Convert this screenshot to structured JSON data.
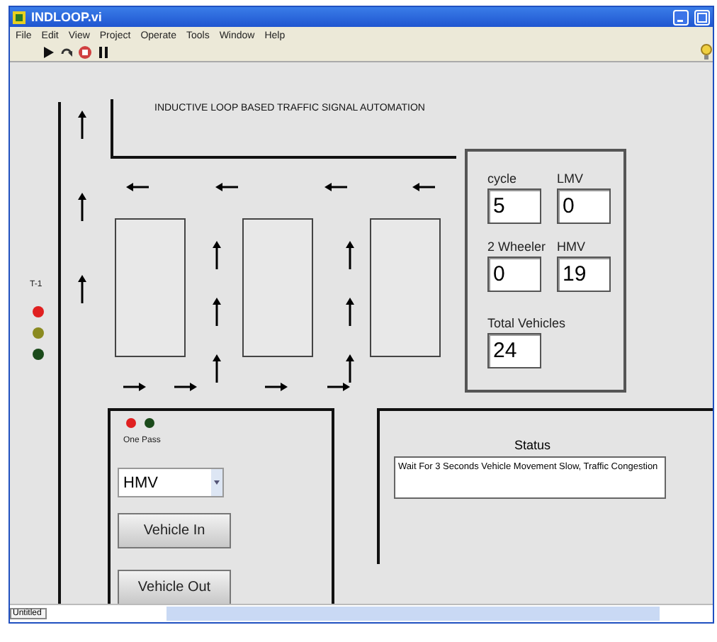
{
  "window": {
    "title": "INDLOOP.vi"
  },
  "menu": [
    "File",
    "Edit",
    "View",
    "Project",
    "Operate",
    "Tools",
    "Window",
    "Help"
  ],
  "heading": "INDUCTIVE LOOP BASED TRAFFIC SIGNAL AUTOMATION",
  "signal": {
    "label": "T-1",
    "lights": [
      {
        "color": "#e02020"
      },
      {
        "color": "#8a8a20"
      },
      {
        "color": "#1a4a1a"
      }
    ]
  },
  "counters": [
    {
      "label": "cycle",
      "value": "5"
    },
    {
      "label": "LMV",
      "value": "0"
    },
    {
      "label": "2 Wheeler",
      "value": "0"
    },
    {
      "label": "HMV",
      "value": "19"
    }
  ],
  "total": {
    "label": "Total Vehicles",
    "value": "24"
  },
  "one_pass": {
    "label": "One Pass",
    "leds": [
      {
        "color": "#e02020"
      },
      {
        "color": "#1a4a1a"
      }
    ]
  },
  "vehicle_type": {
    "value": "HMV"
  },
  "buttons": [
    "Vehicle In",
    "Vehicle Out"
  ],
  "status": {
    "label": "Status",
    "text": "Wait For 3 Seconds Vehicle Movement Slow, Traffic Congestion"
  },
  "status_bar": {
    "label": "Untitled"
  }
}
